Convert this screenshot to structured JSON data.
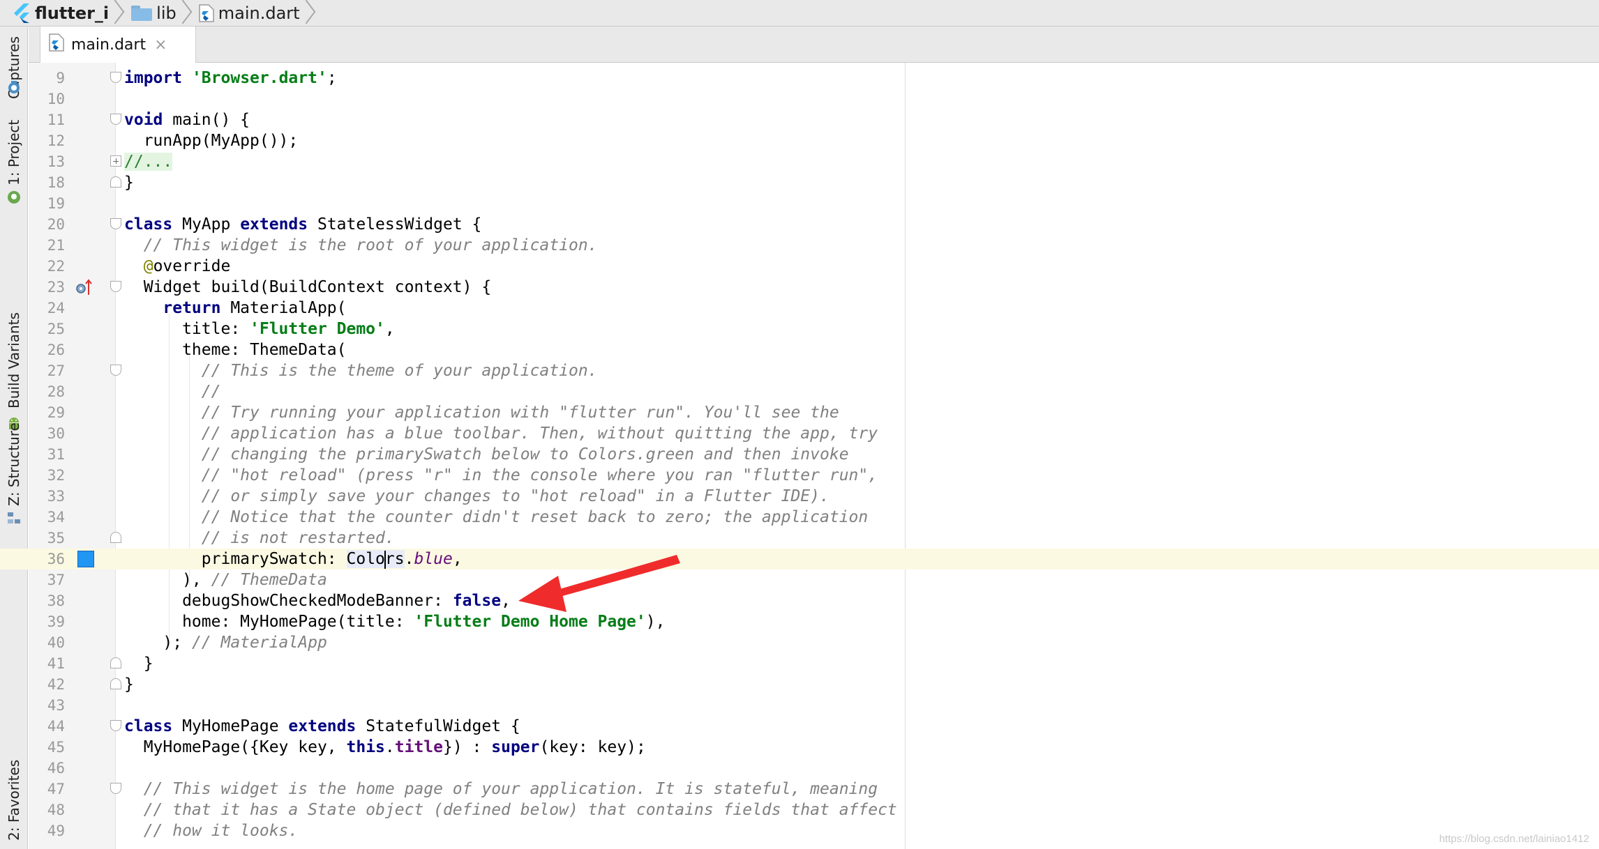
{
  "breadcrumb": {
    "items": [
      {
        "label": "flutter_i",
        "icon": "flutter-icon"
      },
      {
        "label": "lib",
        "icon": "folder-icon"
      },
      {
        "label": "main.dart",
        "icon": "dart-file-icon"
      }
    ]
  },
  "tool_windows": {
    "captures": "Captures",
    "project": "1: Project",
    "build_variants": "Build Variants",
    "structure": "Z: Structure",
    "favorites": "2: Favorites"
  },
  "editor_tab": {
    "label": "main.dart",
    "close": "×"
  },
  "code_lines": [
    {
      "n": "9"
    },
    {
      "n": "10"
    },
    {
      "n": "11"
    },
    {
      "n": "12"
    },
    {
      "n": "13"
    },
    {
      "n": "18"
    },
    {
      "n": "19"
    },
    {
      "n": "20"
    },
    {
      "n": "21"
    },
    {
      "n": "22"
    },
    {
      "n": "23"
    },
    {
      "n": "24"
    },
    {
      "n": "25"
    },
    {
      "n": "26"
    },
    {
      "n": "27"
    },
    {
      "n": "28"
    },
    {
      "n": "29"
    },
    {
      "n": "30"
    },
    {
      "n": "31"
    },
    {
      "n": "32"
    },
    {
      "n": "33"
    },
    {
      "n": "34"
    },
    {
      "n": "35"
    },
    {
      "n": "36"
    },
    {
      "n": "37"
    },
    {
      "n": "38"
    },
    {
      "n": "39"
    },
    {
      "n": "40"
    },
    {
      "n": "41"
    },
    {
      "n": "42"
    },
    {
      "n": "43"
    },
    {
      "n": "44"
    },
    {
      "n": "45"
    },
    {
      "n": "46"
    },
    {
      "n": "47"
    },
    {
      "n": "48"
    },
    {
      "n": "49"
    }
  ],
  "code": {
    "l9": {
      "kw": "import",
      "str": "'Browser.dart'",
      "end": ";"
    },
    "l11": {
      "kw": "void",
      "rest": " main() {"
    },
    "l12": {
      "text": "  runApp(MyApp());"
    },
    "l13": {
      "fold": "//..."
    },
    "l18": {
      "text": "}"
    },
    "l20": {
      "kw1": "class",
      "name": " MyApp ",
      "kw2": "extends",
      "rest": " StatelessWidget {"
    },
    "l21": {
      "cmt": "  // This widget is the root of your application."
    },
    "l22": {
      "indent": "  ",
      "ann": "@",
      "rest": "override"
    },
    "l23": {
      "text": "  Widget build(BuildContext context) {"
    },
    "l24": {
      "indent": "    ",
      "kw": "return",
      "rest": " MaterialApp("
    },
    "l25": {
      "pre": "      title: ",
      "str": "'Flutter Demo'",
      "end": ","
    },
    "l26": {
      "text": "      theme: ThemeData("
    },
    "l27": {
      "cmt": "        // This is the theme of your application."
    },
    "l28": {
      "cmt": "        //"
    },
    "l29": {
      "cmt": "        // Try running your application with \"flutter run\". You'll see the"
    },
    "l30": {
      "cmt": "        // application has a blue toolbar. Then, without quitting the app, try"
    },
    "l31": {
      "cmt": "        // changing the primarySwatch below to Colors.green and then invoke"
    },
    "l32": {
      "cmt": "        // \"hot reload\" (press \"r\" in the console where you ran \"flutter run\","
    },
    "l33": {
      "cmt": "        // or simply save your changes to \"hot reload\" in a Flutter IDE)."
    },
    "l34": {
      "cmt": "        // Notice that the counter didn't reset back to zero; the application"
    },
    "l35": {
      "cmt": "        // is not restarted."
    },
    "l36": {
      "pre": "        primarySwatch: ",
      "sym1": "Colo",
      "sym2": "rs",
      "dot": ".",
      "fld": "blue",
      "end": ","
    },
    "l37": {
      "pre": "      ), ",
      "cmt": "// ThemeData"
    },
    "l38": {
      "pre": "      debugShowCheckedModeBanner: ",
      "kw": "false",
      "end": ","
    },
    "l39": {
      "pre": "      home: MyHomePage(title: ",
      "str": "'Flutter Demo Home Page'",
      "end": "),"
    },
    "l40": {
      "pre": "    ); ",
      "cmt": "// MaterialApp"
    },
    "l41": {
      "text": "  }"
    },
    "l42": {
      "text": "}"
    },
    "l44": {
      "kw1": "class",
      "name": " MyHomePage ",
      "kw2": "extends",
      "rest": " StatefulWidget {"
    },
    "l45": {
      "pre": "  MyHomePage({Key key, ",
      "kw1": "this",
      "dot": ".",
      "pfld": "title",
      "mid": "}) : ",
      "kw2": "super",
      "end": "(key: key);"
    },
    "l47": {
      "cmt": "  // This widget is the home page of your application. It is stateful, meaning"
    },
    "l48": {
      "cmt": "  // that it has a State object (defined below) that contains fields that affect"
    },
    "l49": {
      "cmt": "  // how it looks."
    }
  },
  "colors": {
    "swatch": "#2196f3",
    "arrow": "#f02b2b",
    "keyword": "#000080",
    "string": "#067d17",
    "comment": "#808080"
  },
  "watermark": "https://blog.csdn.net/lainiao1412"
}
